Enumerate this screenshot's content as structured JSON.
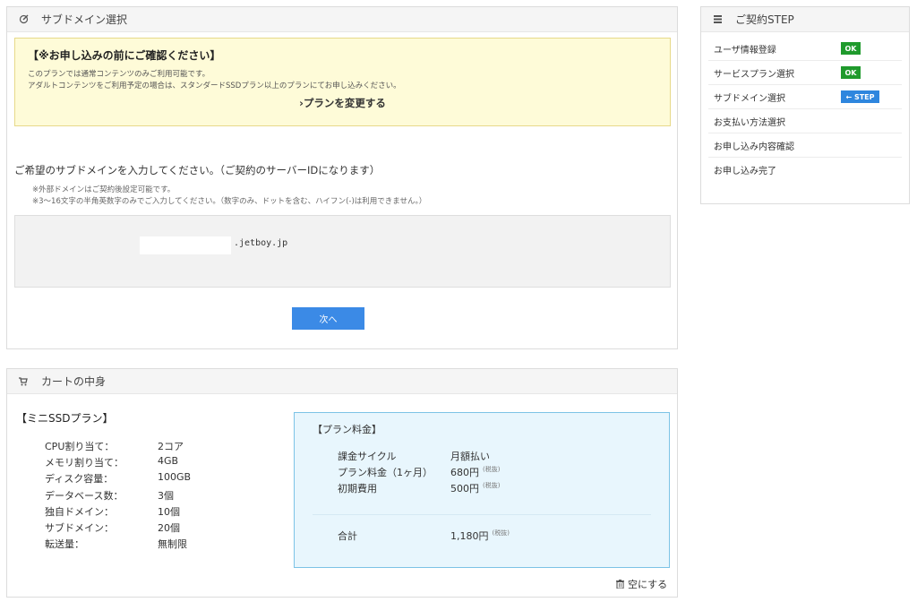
{
  "subdomain": {
    "title": "サブドメイン選択",
    "notice_title": "【※お申し込みの前にご確認ください】",
    "notice_line1": "このプランでは通常コンテンツのみご利用可能です。",
    "notice_line2": "アダルトコンテンツをご利用予定の場合は、スタンダードSSDプラン以上のプランにてお申し込みください。",
    "change_plan_link": "›プランを変更する",
    "prompt": "ご希望のサブドメインを入力してください。（ご契約のサーバーIDになります）",
    "hint1": "※外部ドメインはご契約後設定可能です。",
    "hint2": "※3～16文字の半角英数字のみでご入力してください。（数字のみ、ドットを含む、ハイフン(-)は利用できません。）",
    "input_value": "",
    "domain_suffix": ".jetboy.jp",
    "next_button": "次へ"
  },
  "steps": {
    "title": "ご契約STEP",
    "items": [
      {
        "label": "ユーザ情報登録",
        "badge": "OK"
      },
      {
        "label": "サービスプラン選択",
        "badge": "OK"
      },
      {
        "label": "サブドメイン選択",
        "badge": "← STEP"
      },
      {
        "label": "お支払い方法選択",
        "badge": ""
      },
      {
        "label": "お申し込み内容確認",
        "badge": ""
      },
      {
        "label": "お申し込み完了",
        "badge": ""
      }
    ]
  },
  "cart": {
    "title": "カートの中身",
    "plan_name": "【ミニSSDプラン】",
    "specs": [
      {
        "k": "CPU割り当て：",
        "v": "2コア"
      },
      {
        "k": "メモリ割り当て：",
        "v": "4GB"
      },
      {
        "k": "ディスク容量：",
        "v": "100GB"
      },
      {
        "k": "データベース数：",
        "v": "3個"
      },
      {
        "k": "独自ドメイン：",
        "v": "10個"
      },
      {
        "k": "サブドメイン：",
        "v": "20個"
      },
      {
        "k": "転送量：",
        "v": "無制限"
      }
    ],
    "price_title": "【プラン料金】",
    "prices": [
      {
        "k": "課金サイクル",
        "v": "月額払い",
        "tax": ""
      },
      {
        "k": "プラン料金（1ヶ月）",
        "v": "680円",
        "tax": "(税抜)"
      },
      {
        "k": "初期費用",
        "v": "500円",
        "tax": "(税抜)"
      }
    ],
    "total_label": "合計",
    "total_value": "1,180円",
    "total_tax": "(税抜)",
    "empty_button": "空にする"
  }
}
